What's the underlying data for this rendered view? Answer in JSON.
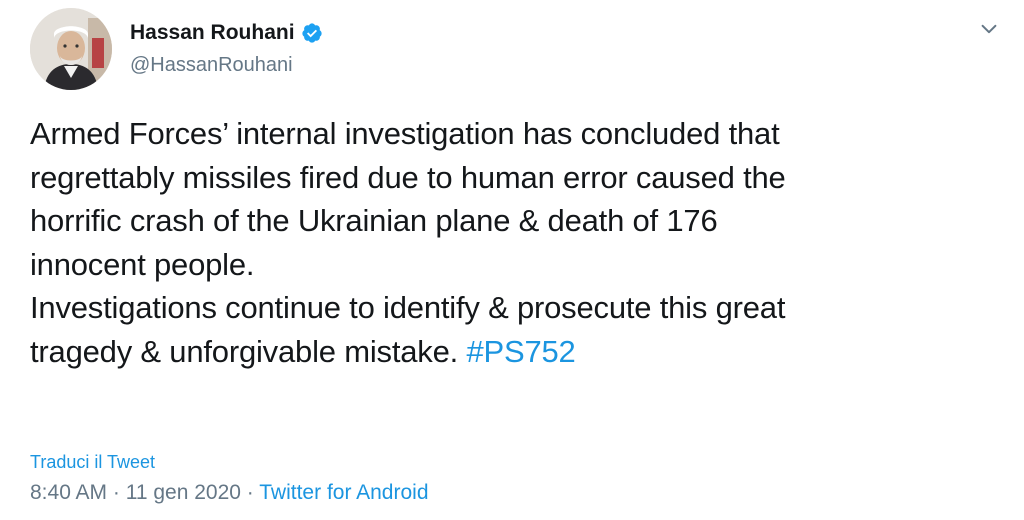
{
  "user": {
    "display_name": "Hassan Rouhani",
    "handle": "@HassanRouhani",
    "verified": true,
    "avatar_icon": "profile-photo"
  },
  "tweet": {
    "lines": [
      "Armed Forces’ internal investigation has concluded that",
      "regrettably missiles fired due to human error caused the",
      "horrific crash of the Ukrainian plane & death of 176",
      "innocent people.",
      "Investigations continue to identify & prosecute this great"
    ],
    "last_line_text": "tragedy & unforgivable mistake.",
    "hashtag": "#PS752"
  },
  "translate_label": "Traduci il Tweet",
  "meta": {
    "time": "8:40 AM",
    "separator1": " · ",
    "date": "11 gen 2020",
    "separator2": " · ",
    "source": "Twitter for Android"
  },
  "colors": {
    "text": "#14171a",
    "secondary": "#657786",
    "link": "#1b95e0",
    "verified": "#1da1f2"
  },
  "icons": {
    "verified": "verified-badge-icon",
    "menu": "chevron-down-icon"
  }
}
